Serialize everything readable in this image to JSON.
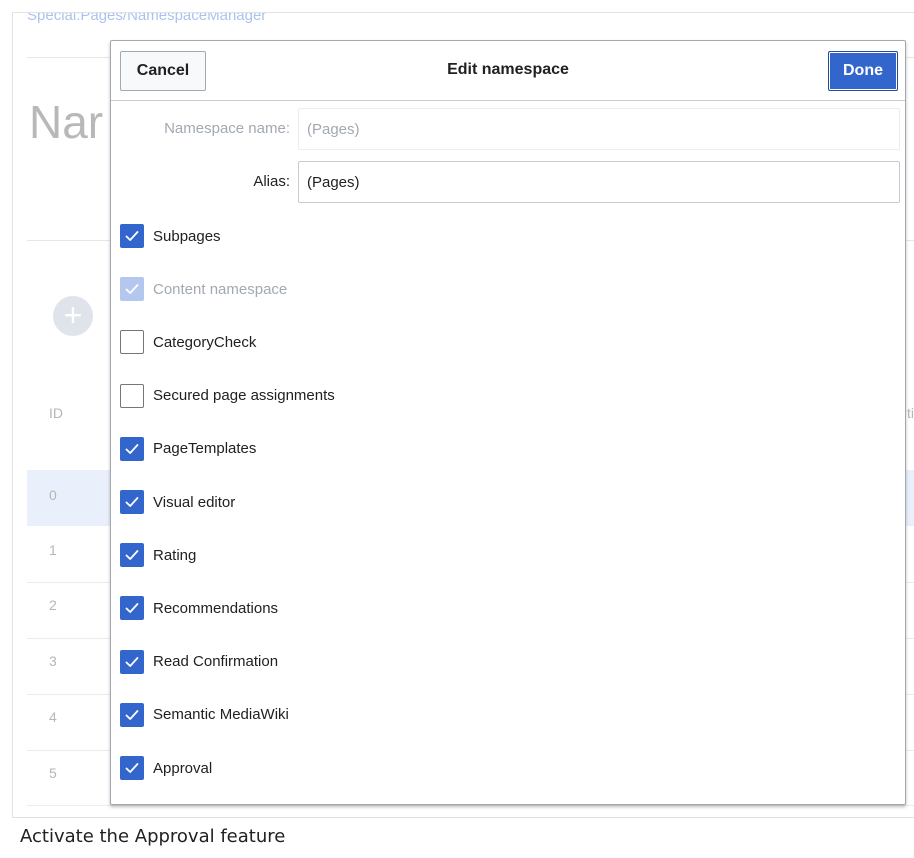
{
  "background": {
    "breadcrumb": "Special:Pages/NamespaceManager",
    "page_title": "Nar",
    "add_icon": "plus-icon",
    "column_id": "ID",
    "edge_text": "ti",
    "rows": [
      "0",
      "1",
      "2",
      "3",
      "4",
      "5"
    ]
  },
  "dialog": {
    "title": "Edit namespace",
    "cancel_label": "Cancel",
    "done_label": "Done",
    "fields": {
      "namespace_name_label": "Namespace name:",
      "namespace_name_value": "(Pages)",
      "alias_label": "Alias:",
      "alias_value": "(Pages)"
    },
    "checkboxes": [
      {
        "label": "Subpages",
        "checked": true,
        "disabled": false
      },
      {
        "label": "Content namespace",
        "checked": true,
        "disabled": true
      },
      {
        "label": "CategoryCheck",
        "checked": false,
        "disabled": false
      },
      {
        "label": "Secured page assignments",
        "checked": false,
        "disabled": false
      },
      {
        "label": "PageTemplates",
        "checked": true,
        "disabled": false
      },
      {
        "label": "Visual editor",
        "checked": true,
        "disabled": false
      },
      {
        "label": "Rating",
        "checked": true,
        "disabled": false
      },
      {
        "label": "Recommendations",
        "checked": true,
        "disabled": false
      },
      {
        "label": "Read Confirmation",
        "checked": true,
        "disabled": false
      },
      {
        "label": "Semantic MediaWiki",
        "checked": true,
        "disabled": false
      },
      {
        "label": "Approval",
        "checked": true,
        "disabled": false
      }
    ]
  },
  "caption": "Activate the Approval feature",
  "colors": {
    "accent": "#3366cc",
    "accent_disabled": "#b3c7ef",
    "row_highlight": "#eaf0fb"
  }
}
